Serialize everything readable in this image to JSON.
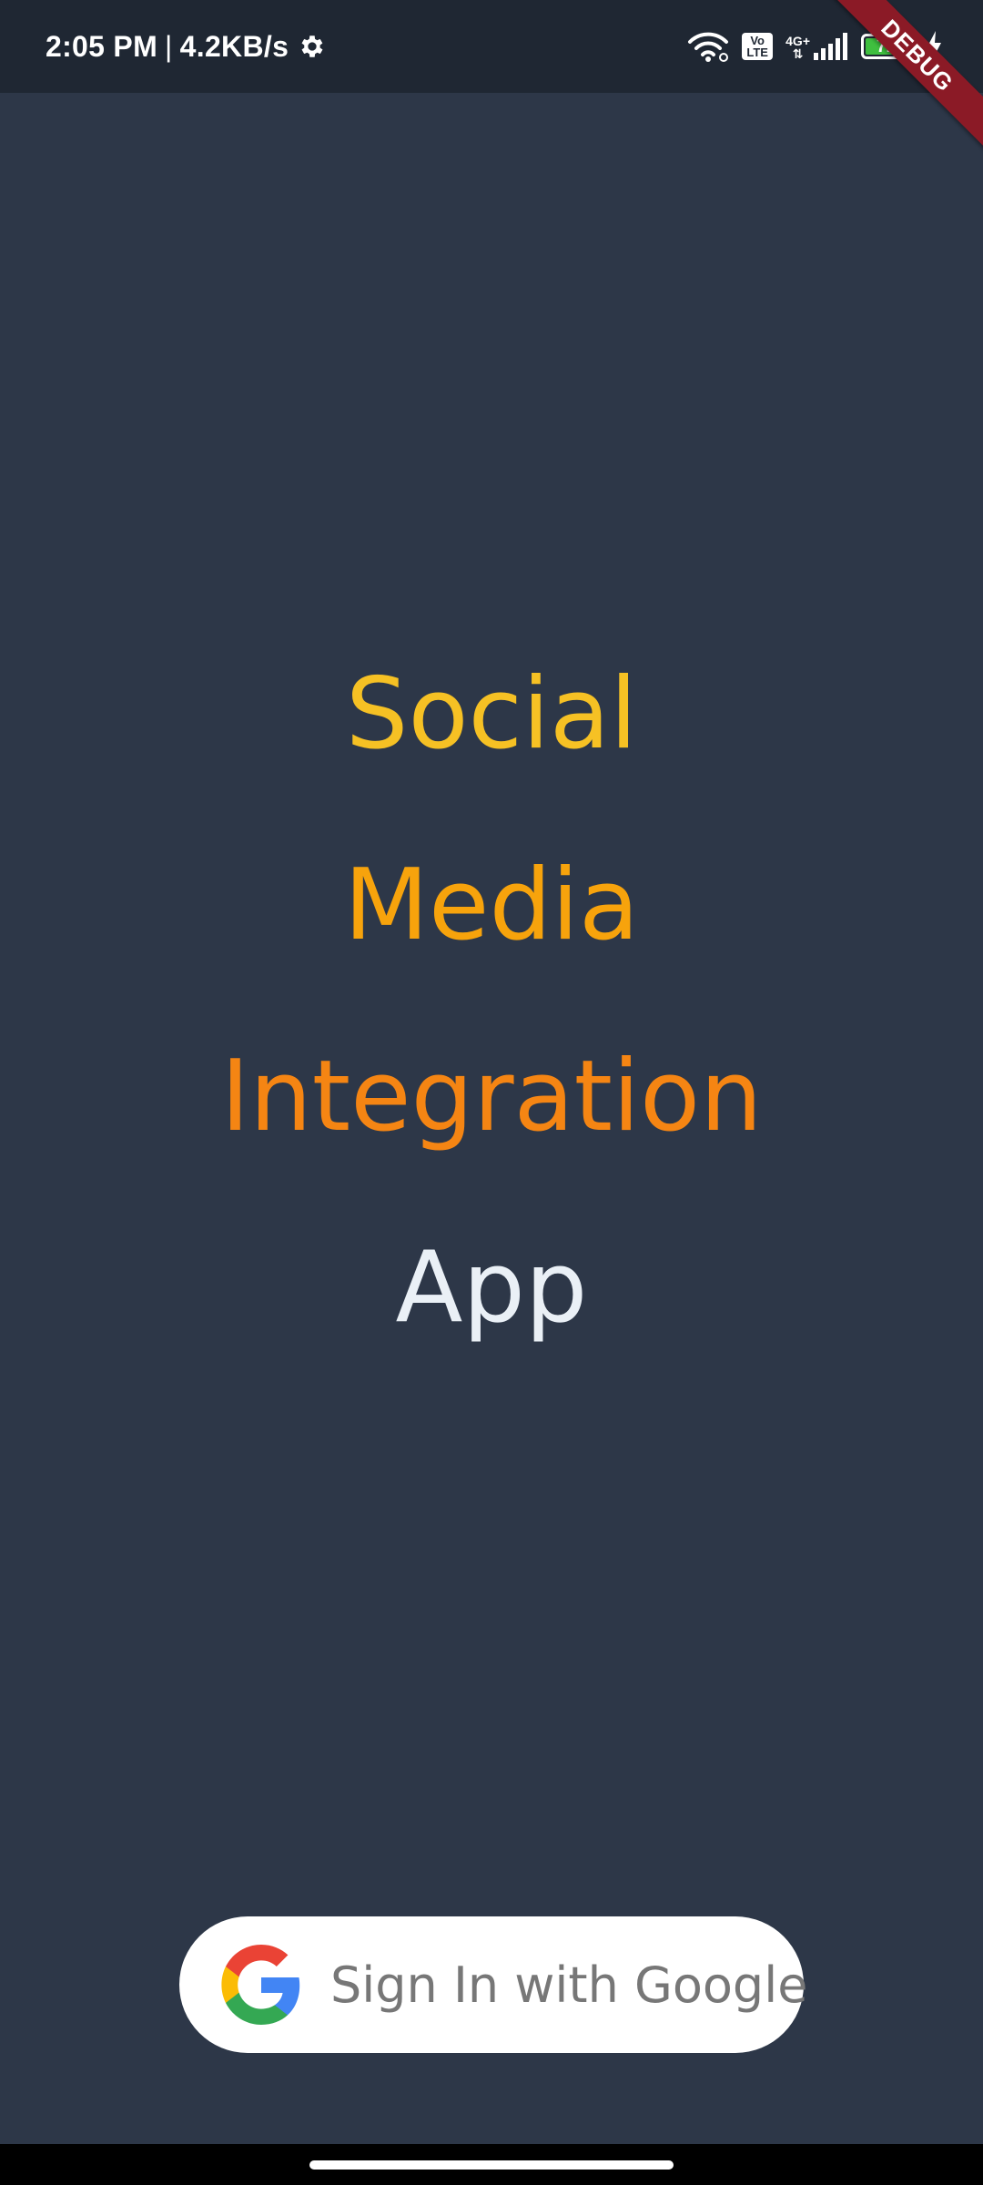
{
  "status_bar": {
    "time": "2:05 PM",
    "separator": "|",
    "speed": "4.2KB/s",
    "volte_top": "Vo",
    "volte_bottom": "LTE",
    "network_type": "4G+",
    "battery_level": "72",
    "battery_fill_fraction": 0.72,
    "icons": [
      "gear-icon",
      "wifi-icon",
      "volte-icon",
      "signal-icon",
      "battery-icon",
      "charging-icon"
    ]
  },
  "debug_banner": {
    "label": "DEBUG"
  },
  "title": {
    "words": [
      "Social",
      "Media",
      "Integration",
      "App"
    ],
    "colors": [
      "#f6c124",
      "#f7a30c",
      "#f58513",
      "#eaf0f6"
    ]
  },
  "sign_in_button": {
    "label": "Sign In with Google",
    "icon": "google-logo-icon"
  },
  "colors": {
    "background": "#2d3748",
    "status_bar": "#1f2733",
    "debug_banner": "#8b1a26"
  }
}
